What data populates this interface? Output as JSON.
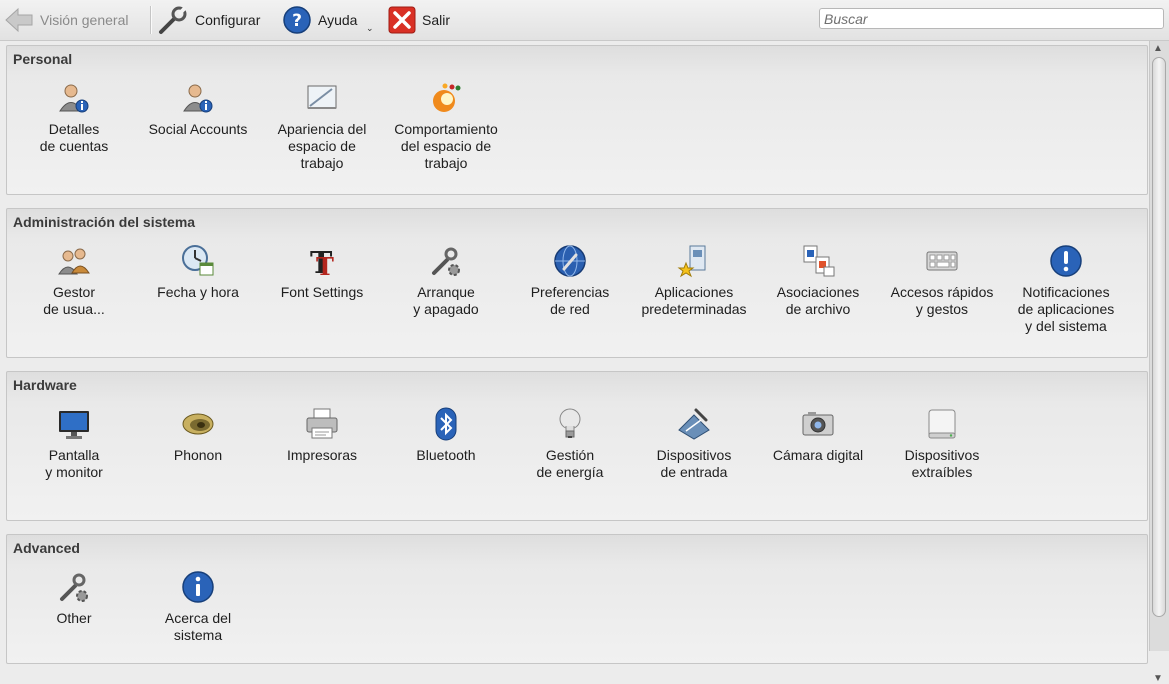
{
  "toolbar": {
    "back_label": "Visión general",
    "configure_label": "Configurar",
    "help_label": "Ayuda",
    "quit_label": "Salir",
    "search_placeholder": "Buscar"
  },
  "sections": {
    "personal": {
      "title": "Personal",
      "items": [
        {
          "label": "Detalles\nde cuentas",
          "icon": "user-info-icon"
        },
        {
          "label": "Social Accounts",
          "icon": "user-info-icon"
        },
        {
          "label": "Apariencia del\nespacio de\ntrabajo",
          "icon": "desktop-appearance-icon"
        },
        {
          "label": "Comportamiento\ndel espacio de\ntrabajo",
          "icon": "workspace-behavior-icon"
        }
      ]
    },
    "system": {
      "title": "Administración del sistema",
      "items": [
        {
          "label": "Gestor\nde usua...",
          "icon": "users-icon"
        },
        {
          "label": "Fecha y hora",
          "icon": "clock-calendar-icon"
        },
        {
          "label": "Font Settings",
          "icon": "font-icon"
        },
        {
          "label": "Arranque\ny apagado",
          "icon": "wrench-gear-icon"
        },
        {
          "label": "Preferencias\nde red",
          "icon": "network-globe-icon"
        },
        {
          "label": "Aplicaciones\npredeterminadas",
          "icon": "default-apps-icon"
        },
        {
          "label": "Asociaciones\nde archivo",
          "icon": "file-associations-icon"
        },
        {
          "label": "Accesos rápidos\ny gestos",
          "icon": "keyboard-icon"
        },
        {
          "label": "Notificaciones\nde aplicaciones\ny del sistema",
          "icon": "notification-icon"
        }
      ]
    },
    "hardware": {
      "title": "Hardware",
      "items": [
        {
          "label": "Pantalla\ny monitor",
          "icon": "monitor-icon"
        },
        {
          "label": "Phonon",
          "icon": "speaker-icon"
        },
        {
          "label": "Impresoras",
          "icon": "printer-icon"
        },
        {
          "label": "Bluetooth",
          "icon": "bluetooth-icon"
        },
        {
          "label": "Gestión\nde energía",
          "icon": "lightbulb-icon"
        },
        {
          "label": "Dispositivos\nde entrada",
          "icon": "input-devices-icon"
        },
        {
          "label": "Cámara digital",
          "icon": "camera-icon"
        },
        {
          "label": "Dispositivos\nextraíbles",
          "icon": "removable-drive-icon"
        }
      ]
    },
    "advanced": {
      "title": "Advanced",
      "items": [
        {
          "label": "Other",
          "icon": "wrench-gear-icon"
        },
        {
          "label": "Acerca del\nsistema",
          "icon": "info-icon"
        }
      ]
    }
  },
  "colors": {
    "accent_blue": "#2a63b8",
    "quit_red": "#d93025",
    "section_border": "#c6c6c6"
  }
}
